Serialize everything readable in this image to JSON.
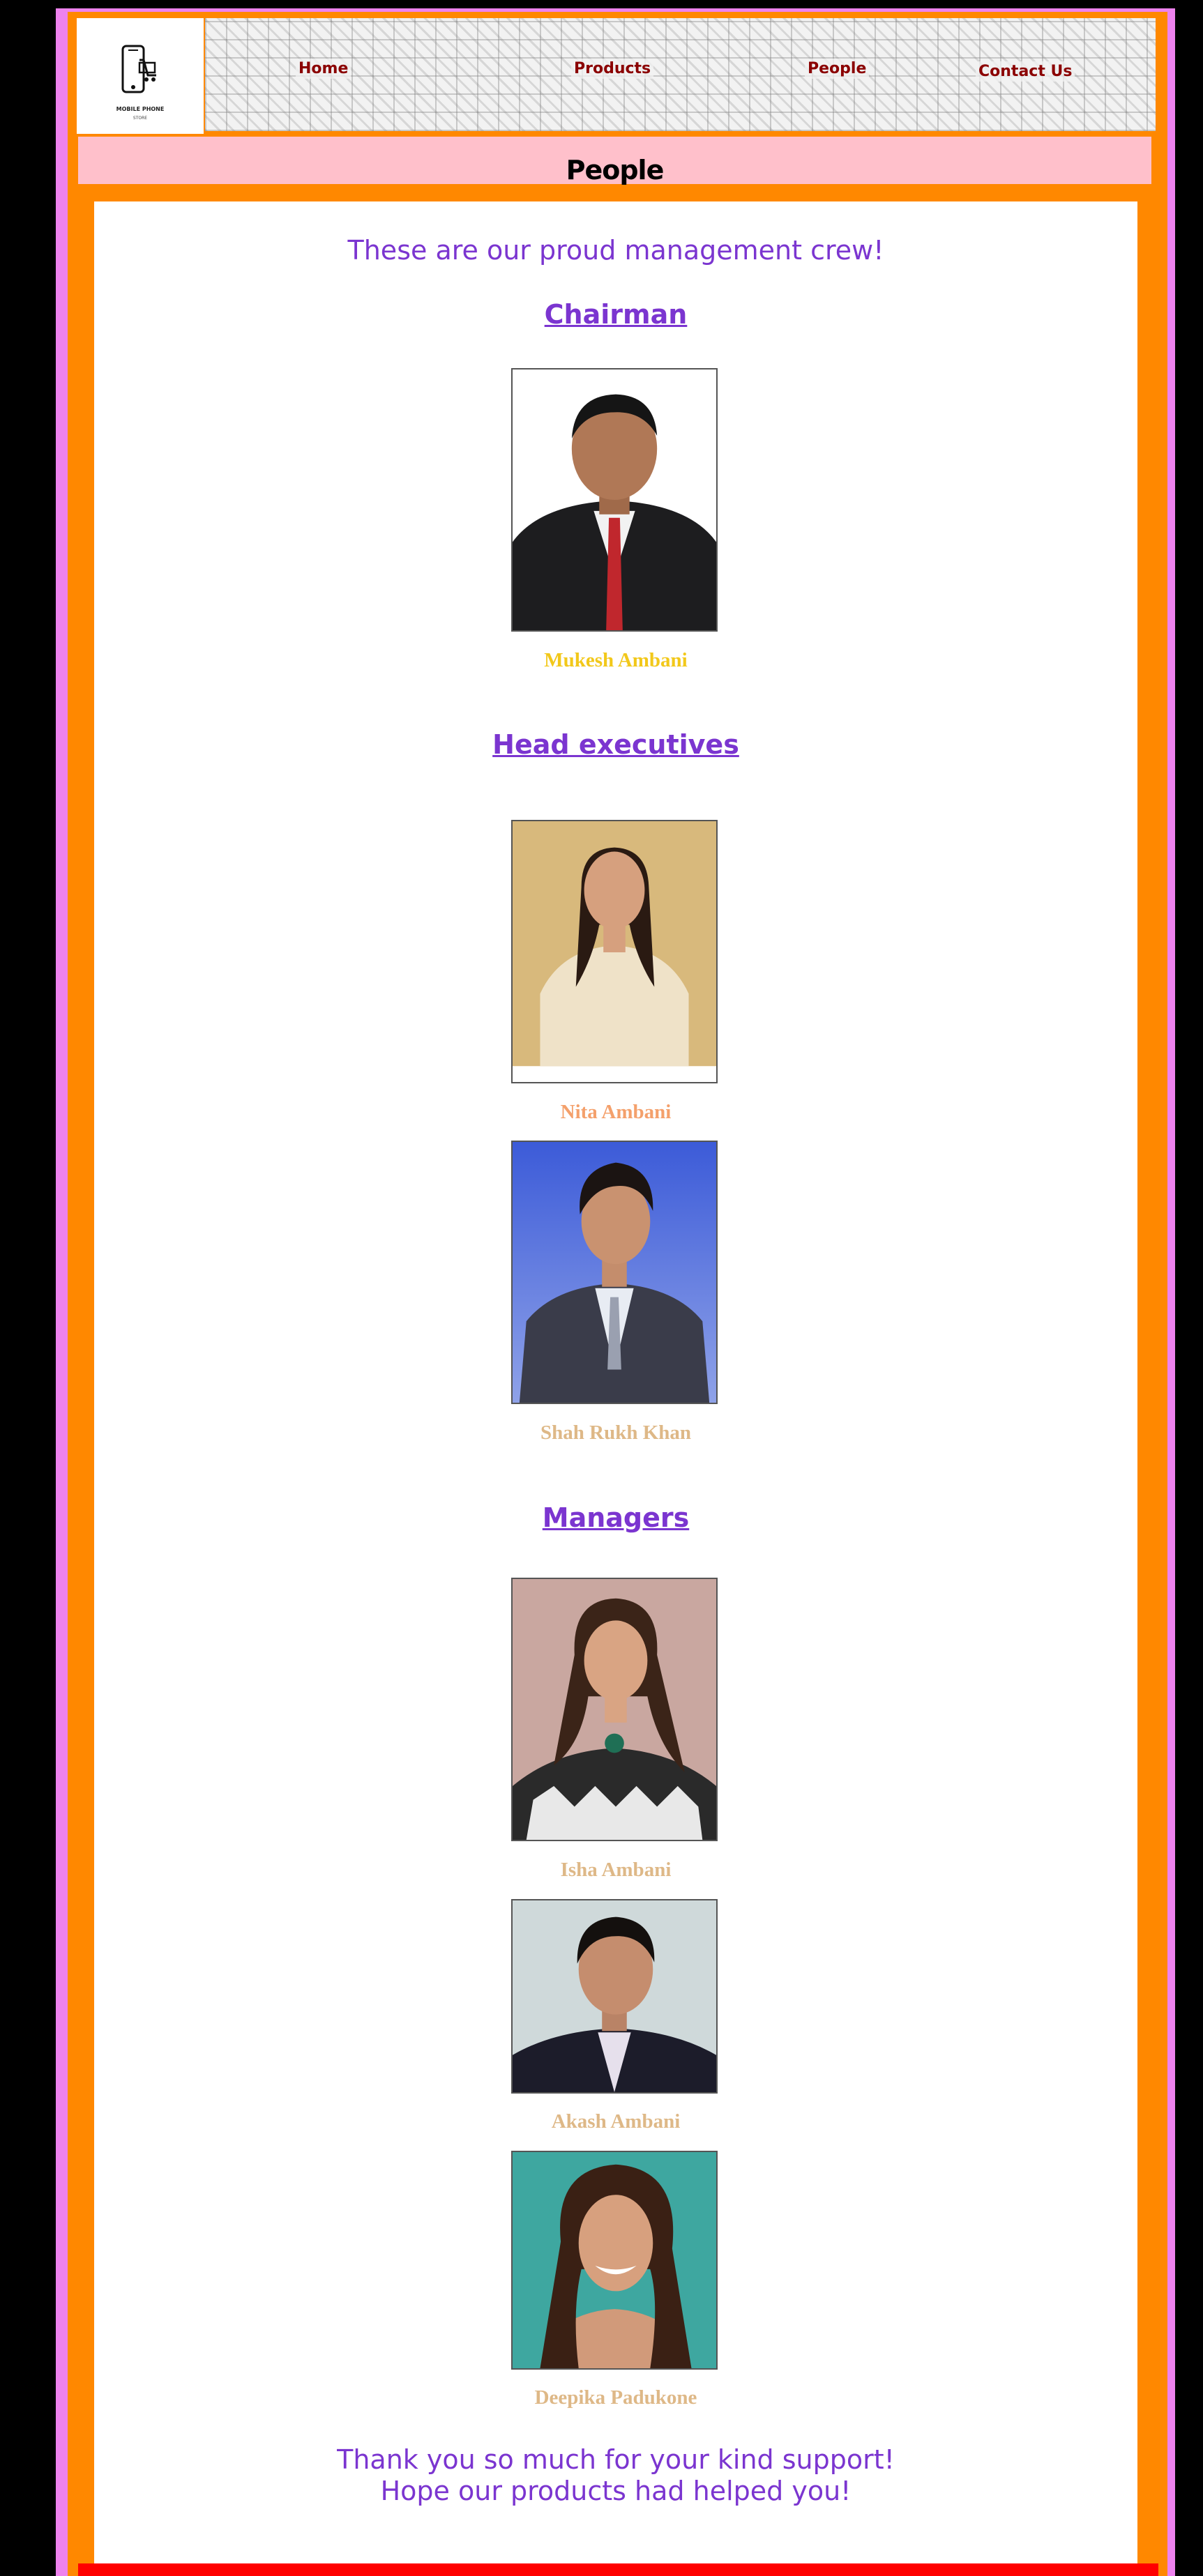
{
  "header": {
    "logo_text": "MOBILE PHONE",
    "logo_subtext": "STORE",
    "nav": [
      {
        "label": "Home"
      },
      {
        "label": "Products"
      },
      {
        "label": "People"
      },
      {
        "label": "Contact Us"
      }
    ]
  },
  "page_title": "People",
  "intro": "These are our proud management crew!",
  "sections": [
    {
      "heading": "Chairman",
      "people": [
        {
          "name": "Mukesh Ambani",
          "name_color": "#f2c81a"
        }
      ]
    },
    {
      "heading": "Head executives",
      "people": [
        {
          "name": "Nita Ambani",
          "name_color": "#f4a06b"
        },
        {
          "name": "Shah Rukh Khan",
          "name_color": "#deb887"
        }
      ]
    },
    {
      "heading": "Managers",
      "people": [
        {
          "name": "Isha Ambani",
          "name_color": "#deb887"
        },
        {
          "name": "Akash Ambani",
          "name_color": "#deb887"
        },
        {
          "name": "Deepika Padukone",
          "name_color": "#deb887"
        }
      ]
    }
  ],
  "thanks": {
    "line1": "Thank you so much for your kind support!",
    "line2": "Hope our products had helped you!"
  },
  "colors": {
    "frame": "#ee82ee",
    "border": "#ff8800",
    "title_bar": "#ffc0cb",
    "text_purple": "#7b35d0",
    "nav_link": "#8b0000",
    "footer": "#ff0000"
  },
  "icons": {
    "logo": "phone-cart-icon"
  }
}
